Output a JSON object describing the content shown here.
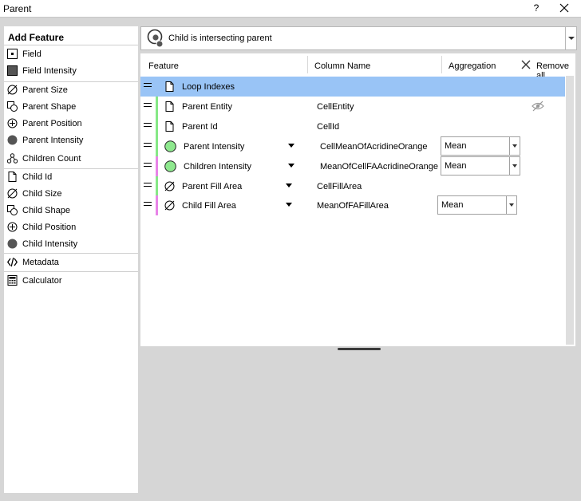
{
  "window": {
    "title": "Parent",
    "help_label": "?",
    "close_icon": "close-icon"
  },
  "sidebar": {
    "header": "Add Feature",
    "items": [
      {
        "label": "Field",
        "icon": "field-icon"
      },
      {
        "label": "Field Intensity",
        "icon": "field-intensity-icon"
      },
      {
        "label": "Parent Size",
        "icon": "size-icon"
      },
      {
        "label": "Parent Shape",
        "icon": "shape-icon"
      },
      {
        "label": "Parent Position",
        "icon": "position-icon"
      },
      {
        "label": "Parent Intensity",
        "icon": "intensity-icon"
      },
      {
        "label": "Children Count",
        "icon": "children-count-icon"
      },
      {
        "label": "Child Id",
        "icon": "document-icon"
      },
      {
        "label": "Child Size",
        "icon": "size-icon"
      },
      {
        "label": "Child Shape",
        "icon": "shape-icon"
      },
      {
        "label": "Child Position",
        "icon": "position-icon"
      },
      {
        "label": "Child Intensity",
        "icon": "intensity-icon"
      },
      {
        "label": "Metadata",
        "icon": "code-icon"
      },
      {
        "label": "Calculator",
        "icon": "calculator-icon"
      }
    ]
  },
  "relation": {
    "label": "Child is intersecting parent",
    "icon": "intersecting-icon"
  },
  "table": {
    "headers": {
      "feature": "Feature",
      "column_name": "Column Name",
      "aggregation": "Aggregation",
      "remove_all": "Remove all"
    },
    "rows": [
      {
        "feature": "Loop Indexes",
        "column": "",
        "aggregation": "",
        "selected": true,
        "bar_color": "",
        "icon": "document-icon"
      },
      {
        "feature": "Parent Entity",
        "column": "CellEntity",
        "aggregation": "",
        "selected": false,
        "bar_color": "#86e886",
        "icon": "document-icon",
        "hidden_icon": "eye-hidden-icon"
      },
      {
        "feature": "Parent Id",
        "column": "CellId",
        "aggregation": "",
        "selected": false,
        "bar_color": "#86e886",
        "icon": "document-icon"
      },
      {
        "feature": "Parent Intensity",
        "column": "CellMeanOfAcridineOrange",
        "aggregation": "Mean",
        "selected": false,
        "bar_color": "#86e886",
        "icon": "green-circle-icon"
      },
      {
        "feature": "Children Intensity",
        "column": "MeanOfCellFAAcridineOrange",
        "aggregation": "Mean",
        "selected": false,
        "bar_color": "#e884e8",
        "icon": "green-circle-icon"
      },
      {
        "feature": "Parent Fill Area",
        "column": "CellFillArea",
        "aggregation": "",
        "selected": false,
        "bar_color": "#86e886",
        "icon": "size-icon"
      },
      {
        "feature": "Child Fill Area",
        "column": "MeanOfFAFillArea",
        "aggregation": "Mean",
        "selected": false,
        "bar_color": "#e884e8",
        "icon": "size-icon"
      }
    ]
  },
  "colors": {
    "selection": "#99c4f6",
    "parent_bar": "#86e886",
    "child_bar": "#e884e8"
  }
}
